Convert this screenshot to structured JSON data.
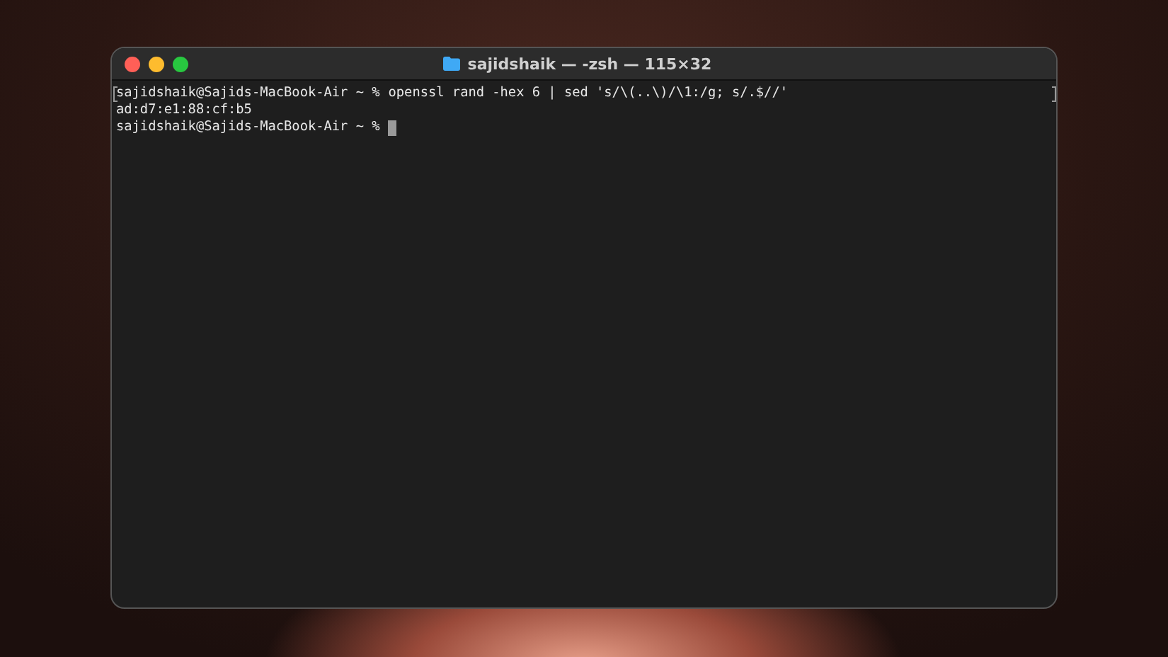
{
  "window": {
    "title": "sajidshaik — -zsh — 115×32"
  },
  "lines": [
    {
      "kind": "command",
      "prompt": "sajidshaik@Sajids-MacBook-Air ~ %",
      "text": "openssl rand -hex 6 | sed 's/\\(..\\)/\\1:/g; s/.$//'",
      "marked": true,
      "cursor": false
    },
    {
      "kind": "output",
      "text": "ad:d7:e1:88:cf:b5",
      "marked": false,
      "cursor": false
    },
    {
      "kind": "command",
      "prompt": "sajidshaik@Sajids-MacBook-Air ~ %",
      "marked": false,
      "cursor": true
    }
  ]
}
